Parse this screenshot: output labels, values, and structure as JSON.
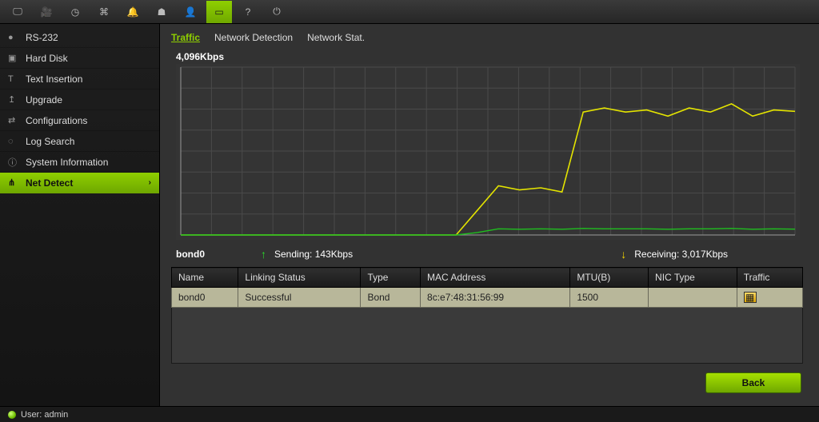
{
  "toolbar_icons": [
    "monitor",
    "camera",
    "clock",
    "network",
    "bell",
    "user-shield",
    "person",
    "battery",
    "help",
    "power"
  ],
  "toolbar_active_index": 7,
  "sidebar": {
    "items": [
      {
        "icon": "●",
        "label": "RS-232"
      },
      {
        "icon": "▣",
        "label": "Hard Disk"
      },
      {
        "icon": "T",
        "label": "Text Insertion"
      },
      {
        "icon": "↥",
        "label": "Upgrade"
      },
      {
        "icon": "⇄",
        "label": "Configurations"
      },
      {
        "icon": "◌",
        "label": "Log Search"
      },
      {
        "icon": "ⓘ",
        "label": "System Information"
      },
      {
        "icon": "⋔",
        "label": "Net Detect"
      }
    ],
    "active_index": 7
  },
  "tabs": [
    {
      "label": "Traffic",
      "active": true
    },
    {
      "label": "Network Detection",
      "active": false
    },
    {
      "label": "Network Stat.",
      "active": false
    }
  ],
  "chart": {
    "y_max_label": "4,096Kbps",
    "interface": "bond0",
    "sending_label": "Sending: 143Kbps",
    "receiving_label": "Receiving: 3,017Kbps"
  },
  "chart_data": {
    "type": "line",
    "xlabel": "",
    "ylabel": "Kbps",
    "ylim": [
      0,
      4096
    ],
    "x": [
      0,
      1,
      2,
      3,
      4,
      5,
      6,
      7,
      8,
      9,
      10,
      11,
      12,
      13,
      14,
      15,
      16,
      17,
      18,
      19,
      20,
      21,
      22,
      23,
      24,
      25,
      26,
      27,
      28,
      29
    ],
    "series": [
      {
        "name": "Receiving",
        "color": "#e4e400",
        "values": [
          0,
          0,
          0,
          0,
          0,
          0,
          0,
          0,
          0,
          0,
          0,
          0,
          0,
          0,
          600,
          1200,
          1100,
          1150,
          1050,
          3000,
          3100,
          3000,
          3050,
          2900,
          3100,
          3000,
          3200,
          2900,
          3050,
          3017
        ]
      },
      {
        "name": "Sending",
        "color": "#1fbf1f",
        "values": [
          0,
          0,
          0,
          0,
          0,
          0,
          0,
          0,
          0,
          0,
          0,
          0,
          0,
          0,
          60,
          150,
          140,
          150,
          140,
          160,
          150,
          150,
          150,
          140,
          150,
          150,
          160,
          140,
          150,
          143
        ]
      }
    ]
  },
  "table": {
    "headers": [
      "Name",
      "Linking Status",
      "Type",
      "MAC Address",
      "MTU(B)",
      "NIC Type",
      "Traffic"
    ],
    "rows": [
      {
        "name": "bond0",
        "status": "Successful",
        "type": "Bond",
        "mac": "8c:e7:48:31:56:99",
        "mtu": "1500",
        "nic": "",
        "traffic_icon": true
      }
    ]
  },
  "back_label": "Back",
  "status": {
    "user_label": "User: admin"
  }
}
